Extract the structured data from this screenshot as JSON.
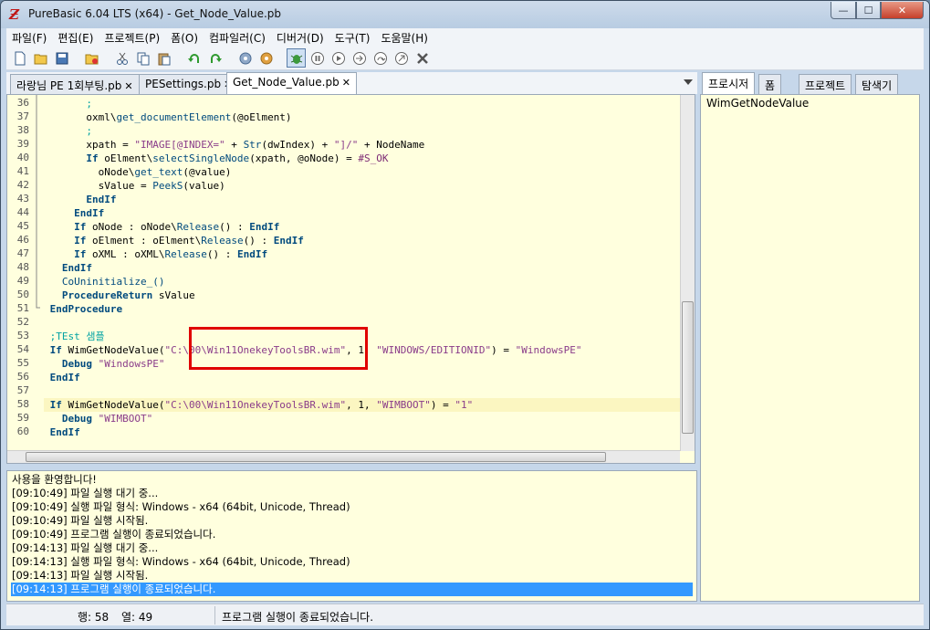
{
  "window": {
    "title": "PureBasic 6.04 LTS (x64) - Get_Node_Value.pb",
    "icon": "purebasic-logo-icon"
  },
  "caption": {
    "min": "—",
    "max": "☐",
    "close": "✕"
  },
  "menu": [
    "파일(F)",
    "편집(E)",
    "프로젝트(P)",
    "폼(O)",
    "컴파일러(C)",
    "디버거(D)",
    "도구(T)",
    "도움말(H)"
  ],
  "file_tabs": [
    {
      "label": "라랑님 PE 1회부팅.pb",
      "close": "✕"
    },
    {
      "label": "PESettings.pb",
      "close": "✕"
    },
    {
      "label": "Get_Node_Value.pb",
      "close": "✕"
    }
  ],
  "line_numbers": [
    "36",
    "37",
    "38",
    "39",
    "40",
    "41",
    "42",
    "43",
    "44",
    "45",
    "46",
    "47",
    "48",
    "49",
    "50",
    "51",
    "52",
    "53",
    "54",
    "55",
    "56",
    "57",
    "58",
    "59",
    "60"
  ],
  "code": {
    "l36": ";",
    "l37a": "oxml\\",
    "l37b": "get_documentElement",
    "l37c": "(@oElment)",
    "l38": ";",
    "l39a": "xpath = ",
    "l39b": "\"IMAGE[@INDEX=\"",
    "l39c": " + ",
    "l39d": "Str",
    "l39e": "(dwIndex) + ",
    "l39f": "\"]/\"",
    "l39g": " + NodeName",
    "l40a": "If",
    "l40b": " oElment\\",
    "l40c": "selectSingleNode",
    "l40d": "(xpath, @oNode) = ",
    "l40e": "#S_OK",
    "l41a": "oNode\\",
    "l41b": "get_text",
    "l41c": "(@value)",
    "l42a": "sValue = ",
    "l42b": "PeekS",
    "l42c": "(value)",
    "l43": "EndIf",
    "l44": "EndIf",
    "l45a": "If",
    "l45b": " oNode : oNode\\",
    "l45c": "Release",
    "l45d": "() : ",
    "l45e": "EndIf",
    "l46a": "If",
    "l46b": " oElment : oElment\\",
    "l46c": "Release",
    "l46d": "() : ",
    "l46e": "EndIf",
    "l47a": "If",
    "l47b": " oXML : oXML\\",
    "l47c": "Release",
    "l47d": "() : ",
    "l47e": "EndIf",
    "l48": "EndIf",
    "l49": "CoUninitialize_()",
    "l50a": "ProcedureReturn",
    "l50b": " sValue",
    "l51": "EndProcedure",
    "l53": ";TEst 샘플",
    "l54a": "If",
    "l54b": " WimGetNodeValue(",
    "l54c": "\"C:\\00\\Win11OnekeyToolsBR.wim\"",
    "l54d": ", 1, ",
    "l54e": "\"WINDOWS/EDITIONID\"",
    "l54f": ") = ",
    "l54g": "\"WindowsPE\"",
    "l55a": "Debug",
    "l55b": " \"WindowsPE\"",
    "l56": "EndIf",
    "l58a": "If",
    "l58b": " WimGetNodeValue(",
    "l58c": "\"C:\\00\\Win11OnekeyToolsBR.wim\"",
    "l58d": ", 1, ",
    "l58e": "\"WIMBOOT\"",
    "l58f": ") = ",
    "l58g": "\"1\"",
    "l59a": "Debug",
    "l59b": " \"WIMBOOT\"",
    "l60": "EndIf"
  },
  "log": [
    "사용을 환영합니다!",
    "[09:10:49] 파일 실행 대기 중...",
    "[09:10:49] 실행 파일 형식: Windows - x64  (64bit, Unicode, Thread)",
    "[09:10:49] 파일 실행 시작됨.",
    "[09:10:49] 프로그램 실행이 종료되었습니다.",
    "[09:14:13] 파일 실행 대기 중...",
    "[09:14:13] 실행 파일 형식: Windows - x64  (64bit, Unicode, Thread)",
    "[09:14:13] 파일 실행 시작됨.",
    "[09:14:13] 프로그램 실행이 종료되었습니다."
  ],
  "right_tabs": [
    "프로시저",
    "폼",
    "프로젝트",
    "탐색기"
  ],
  "right_panel": {
    "items": [
      "WimGetNodeValue"
    ]
  },
  "status": {
    "row_label": "행: 58",
    "col_label": "열: 49",
    "message": "프로그램 실행이 종료되었습니다."
  },
  "colors": {
    "editor_bg": "#ffffde",
    "keyword": "#004a7e",
    "string": "#8a3c8a",
    "comment": "#00a2a2",
    "highlight_box": "#e00000",
    "selected_log": "#3399ff"
  }
}
